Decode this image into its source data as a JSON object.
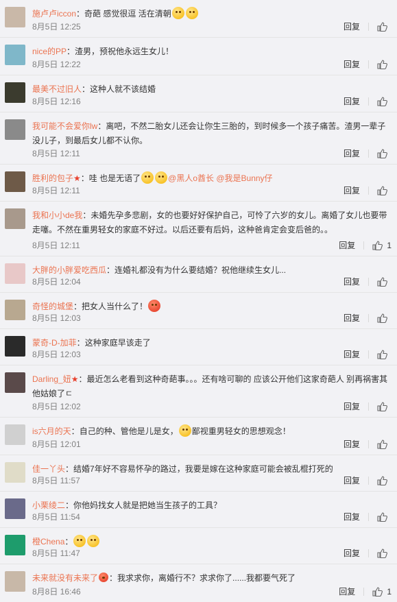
{
  "colors": {
    "username": "#eb7350",
    "time": "#808080",
    "text": "#333333"
  },
  "labels": {
    "reply": "回复"
  },
  "comments": [
    {
      "user": "施卢卢iccon",
      "sep": "：",
      "text": "奇葩 感觉很逗 活在清朝",
      "text2": "",
      "emojis_after": 2,
      "time": "8月5日 12:25",
      "likes": "",
      "avatar_color": "#c9b8a8"
    },
    {
      "user": "nice的PP",
      "sep": "：",
      "text": "渣男，预祝他永远生女儿！",
      "text2": "",
      "emojis_after": 0,
      "time": "8月5日 12:22",
      "likes": "",
      "avatar_color": "#7fb7c9"
    },
    {
      "user": "最美不过旧人",
      "sep": "：",
      "text": "这种人就不该结婚",
      "text2": "",
      "emojis_after": 0,
      "time": "8月5日 12:16",
      "likes": "",
      "avatar_color": "#3b3b2e"
    },
    {
      "user": "我可能不会爱你lw",
      "sep": "：",
      "text": "离吧，不然二胎女儿还会让你生三胎的，到时候多一个孩子痛苦。渣男一辈子没儿子，到最后女儿都不认你。",
      "text2": "",
      "emojis_after": 0,
      "time": "8月5日 12:11",
      "likes": "",
      "avatar_color": "#8a8a8a"
    },
    {
      "user": "胜利的包子",
      "star": "★",
      "sep": "：",
      "text": "哇 也是无语了",
      "text2": "",
      "emojis_after": 2,
      "mentions": [
        "@黑人o酋长",
        "@我是Bunny仔"
      ],
      "time": "8月5日 12:11",
      "likes": "",
      "avatar_color": "#6e5a48"
    },
    {
      "user": "我和小小de我",
      "sep": "：",
      "text": "未婚先孕多悲剧，女的也要好好保护自己，可怜了六岁的女儿。离婚了女儿也要带走噻。不然在重男轻女的家庭不好过。以后还要有后妈，这种爸肯定会变后爸的。。",
      "text2": "",
      "emojis_after": 0,
      "time": "8月5日 12:11",
      "likes": "1",
      "avatar_color": "#a8998c"
    },
    {
      "user": "大胖的小胖爱吃西瓜",
      "sep": "：",
      "text": "连婚礼都没有为什么要结婚？祝他继续生女儿...",
      "text2": "",
      "emojis_after": 0,
      "time": "8月5日 12:04",
      "likes": "",
      "avatar_color": "#e8c8c8"
    },
    {
      "user": "奇怪的城堡",
      "sep": "：",
      "text": "把女人当什么了！",
      "text2": "",
      "emojis_after": 0,
      "angry": true,
      "time": "8月5日 12:03",
      "likes": "",
      "avatar_color": "#b8a890"
    },
    {
      "user": "蒙奇-D-加菲",
      "sep": "：",
      "text": "这种家庭早该走了",
      "text2": "",
      "emojis_after": 0,
      "time": "8月5日 12:03",
      "likes": "",
      "avatar_color": "#2a2a2a"
    },
    {
      "user": "Darling_妞",
      "star": "★",
      "sep": "：",
      "text": "最近怎么老看到这种奇葩事。。。还有啥可聊的 应该公开他们这家奇葩人 别再祸害其他姑娘了ㄷ",
      "text2": "",
      "emojis_after": 0,
      "time": "8月5日 12:02",
      "likes": "",
      "avatar_color": "#5a4a4a"
    },
    {
      "user": "is六月的天",
      "sep": "：",
      "text": "自己的种、管他是儿是女，",
      "text2": "鄙视重男轻女的思想观念！",
      "emojis_after": 0,
      "mid_emoji": true,
      "time": "8月5日 12:01",
      "likes": "",
      "avatar_color": "#d0d0d0"
    },
    {
      "user": "佳一丫头",
      "sep": "：",
      "text": "结婚7年好不容易怀孕的路过，我要是嫁在这种家庭可能会被乱棍打死的",
      "text2": "",
      "emojis_after": 0,
      "time": "8月5日 11:57",
      "likes": "",
      "avatar_color": "#e0dcc8"
    },
    {
      "user": "小栗绫二",
      "sep": "：",
      "text": "你他妈找女人就是把她当生孩子的工具？",
      "text2": "",
      "emojis_after": 0,
      "time": "8月5日 11:54",
      "likes": "",
      "avatar_color": "#6a6a8a"
    },
    {
      "user": "橙Chena",
      "sep": "：",
      "text": "",
      "text2": "",
      "emojis_after": 2,
      "time": "8月5日 11:47",
      "likes": "",
      "avatar_color": "#1e9c6c"
    },
    {
      "user": "未来就没有未来了",
      "badge": true,
      "sep": "：",
      "text": "我求求你，离婚行不？求求你了......我都要气死了",
      "text2": "",
      "emojis_after": 0,
      "time": "8月8日 16:46",
      "likes": "1",
      "avatar_color": "#c8b8a8"
    }
  ]
}
